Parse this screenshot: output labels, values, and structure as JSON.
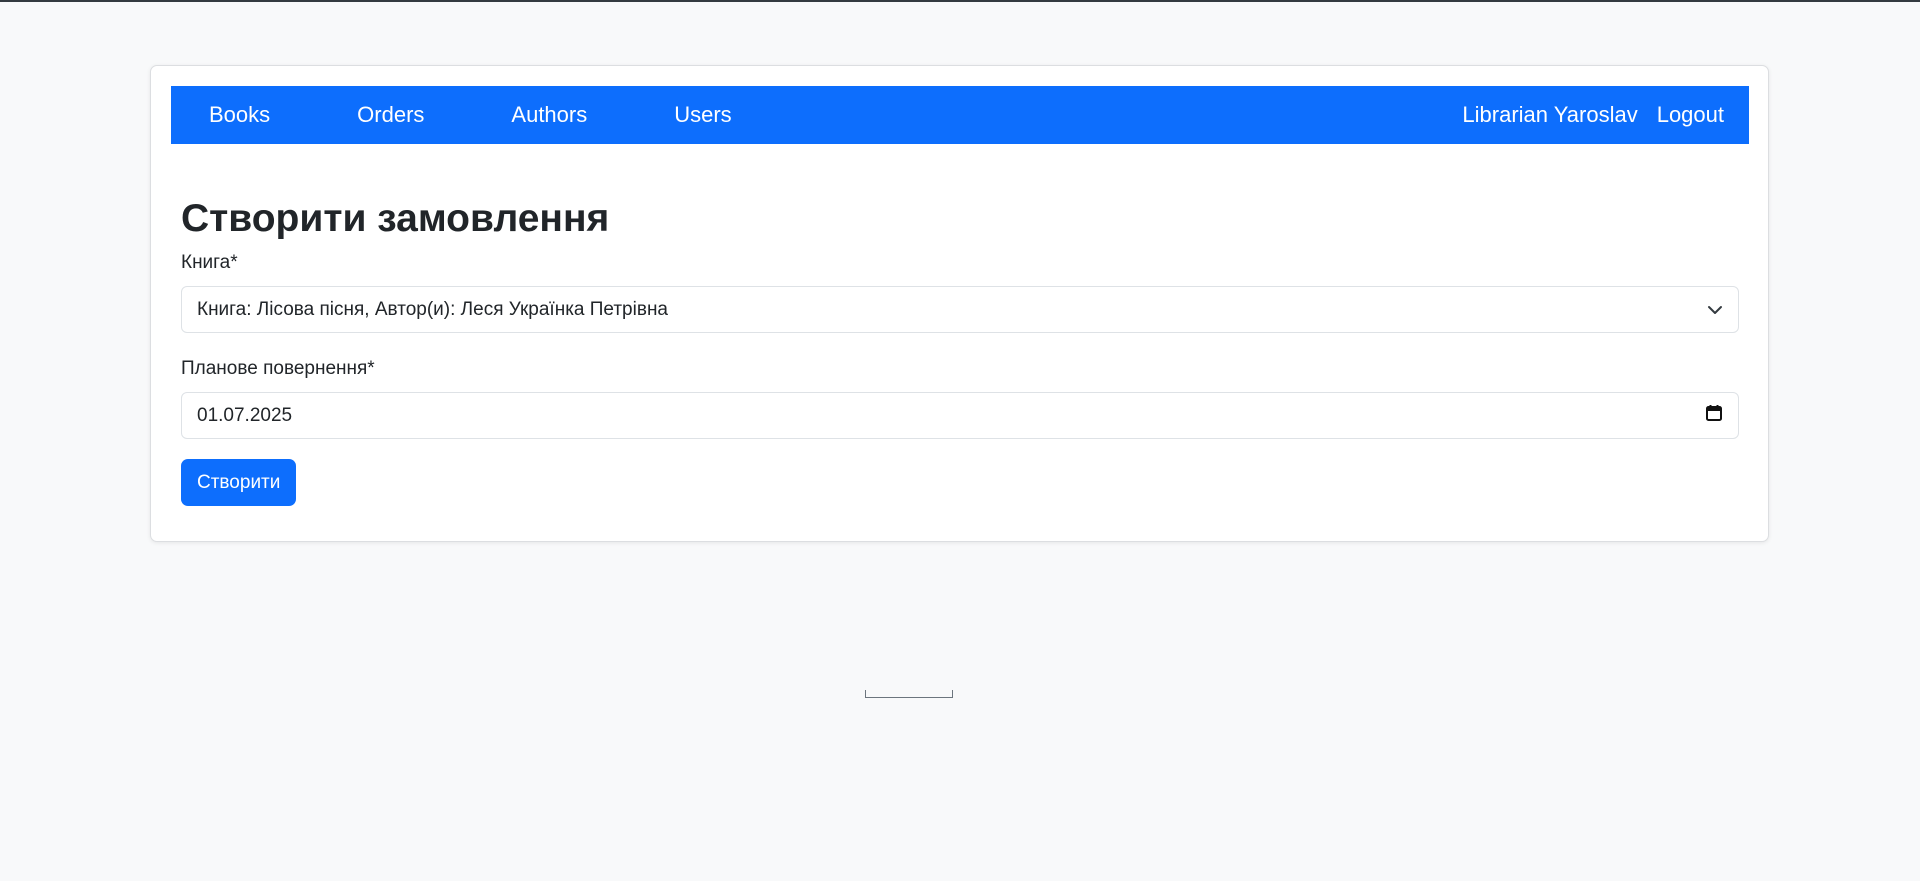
{
  "nav": {
    "items": [
      {
        "label": "Books"
      },
      {
        "label": "Orders"
      },
      {
        "label": "Authors"
      },
      {
        "label": "Users"
      }
    ],
    "user_label": "Librarian Yaroslav",
    "logout_label": "Logout",
    "background_color": "#0d6efd"
  },
  "page": {
    "title": "Створити замовлення"
  },
  "form": {
    "book_label": "Книга*",
    "book_value": "Книга: Лісова пісня, Автор(и): Леся Українка Петрівна",
    "return_label": "Планове повернення*",
    "return_value": "01.07.2025",
    "submit_label": "Створити"
  },
  "icons": {
    "select": "chevron-down-icon",
    "date": "calendar-icon"
  },
  "colors": {
    "accent": "#0d6efd",
    "page_background": "#f8f9fa"
  }
}
